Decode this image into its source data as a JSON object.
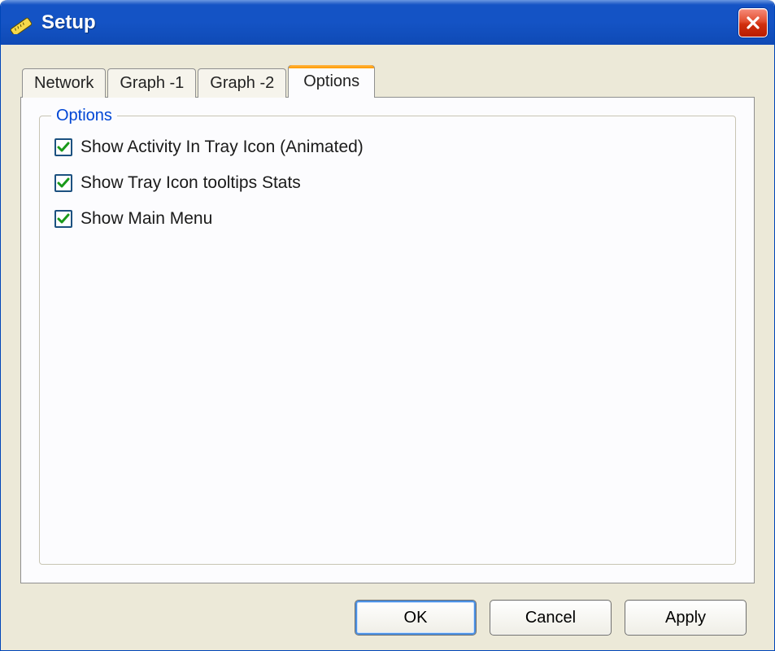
{
  "window": {
    "title": "Setup",
    "close_tooltip": "Close"
  },
  "tabs": {
    "network": "Network",
    "graph1": "Graph -1",
    "graph2": "Graph -2",
    "options": "Options",
    "active": "options"
  },
  "options_group": {
    "legend": "Options",
    "items": [
      {
        "label": "Show Activity In Tray Icon (Animated)",
        "checked": true
      },
      {
        "label": "Show Tray Icon tooltips Stats",
        "checked": true
      },
      {
        "label": "Show Main Menu",
        "checked": true
      }
    ]
  },
  "buttons": {
    "ok": "OK",
    "cancel": "Cancel",
    "apply": "Apply"
  }
}
